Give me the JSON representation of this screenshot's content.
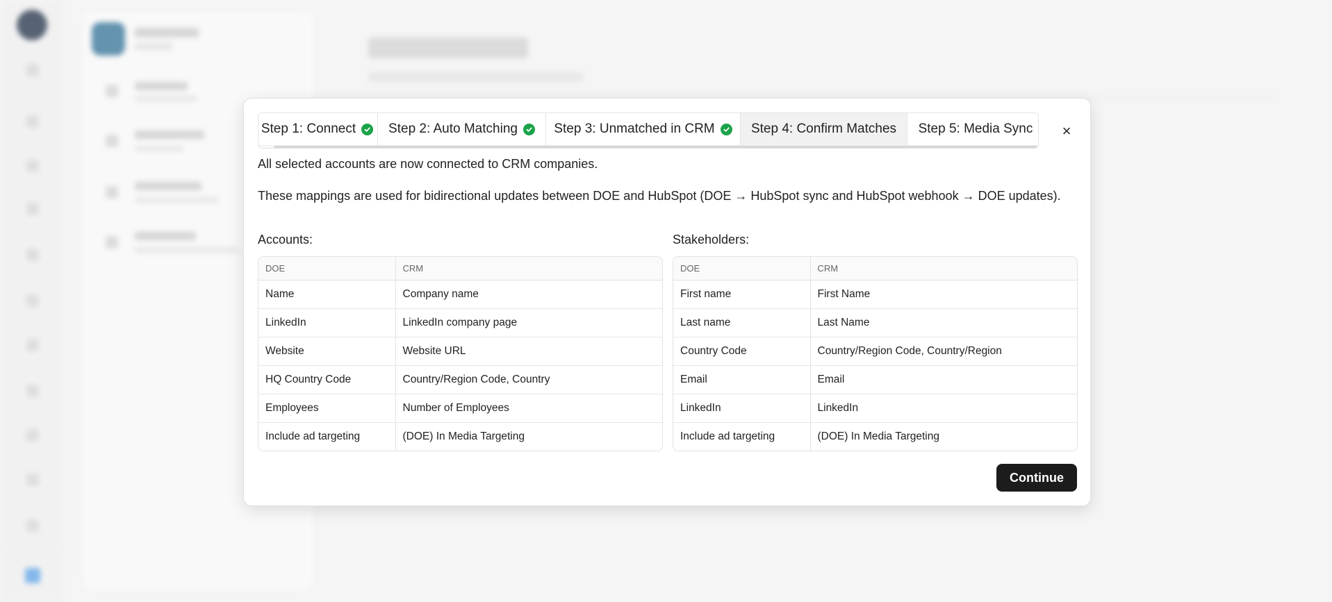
{
  "steps": [
    {
      "label": "Step 1: Connect",
      "done": true
    },
    {
      "label": "Step 2: Auto Matching",
      "done": true
    },
    {
      "label": "Step 3: Unmatched in CRM",
      "done": true
    },
    {
      "label": "Step 4: Confirm Matches",
      "done": false,
      "active": true
    },
    {
      "label": "Step 5: Media Sync",
      "done": false
    }
  ],
  "close_label": "×",
  "intro": "All selected accounts are now connected to CRM companies.",
  "description": "These mappings are used for bidirectional updates between DOE and HubSpot (DOE → HubSpot sync and HubSpot webhook → DOE updates).",
  "accounts": {
    "title": "Accounts:",
    "headers": [
      "DOE",
      "CRM"
    ],
    "rows": [
      [
        "Name",
        "Company name"
      ],
      [
        "LinkedIn",
        "LinkedIn company page"
      ],
      [
        "Website",
        "Website URL"
      ],
      [
        "HQ Country Code",
        "Country/Region Code, Country"
      ],
      [
        "Employees",
        "Number of Employees"
      ],
      [
        "Include ad targeting",
        "(DOE) In Media Targeting"
      ]
    ]
  },
  "stakeholders": {
    "title": "Stakeholders:",
    "headers": [
      "DOE",
      "CRM"
    ],
    "rows": [
      [
        "First name",
        "First Name"
      ],
      [
        "Last name",
        "Last Name"
      ],
      [
        "Country Code",
        "Country/Region Code, Country/Region"
      ],
      [
        "Email",
        "Email"
      ],
      [
        "LinkedIn",
        "LinkedIn"
      ],
      [
        "Include ad targeting",
        "(DOE) In Media Targeting"
      ]
    ]
  },
  "continue_label": "Continue",
  "colors": {
    "check": "#1aa34a",
    "primary_button": "#1c1c1c"
  }
}
